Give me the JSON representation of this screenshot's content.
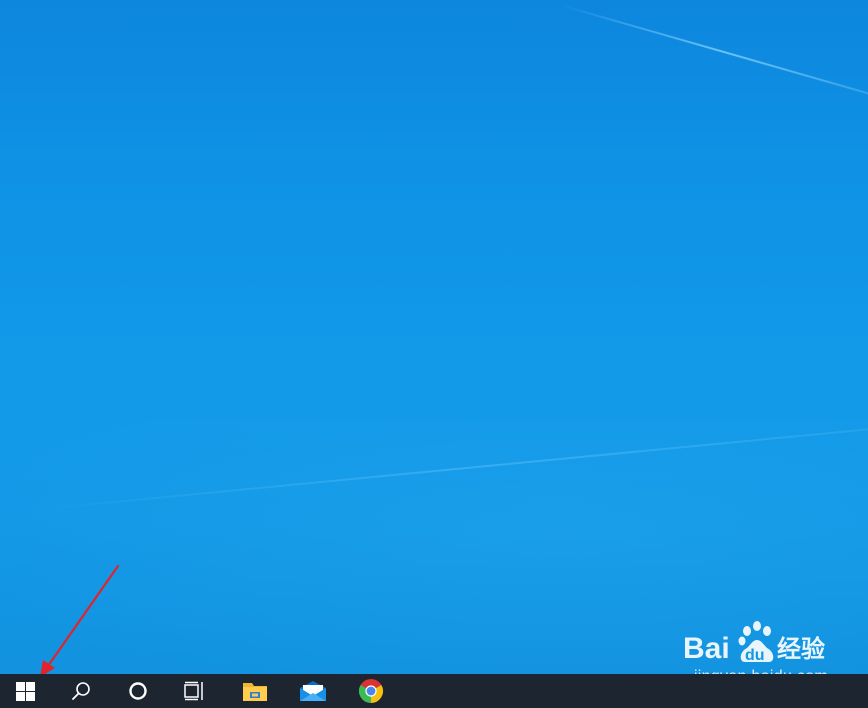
{
  "colors": {
    "desktop_top": "#0d86de",
    "desktop_bottom": "#1292df",
    "taskbar": "#1c2530",
    "annotation_arrow": "#e0242b",
    "icon_white": "#ffffff"
  },
  "taskbar": {
    "start": {
      "icon": "windows-logo-icon"
    },
    "search": {
      "icon": "search-icon"
    },
    "cortana": {
      "icon": "cortana-circle-icon"
    },
    "task_view": {
      "icon": "task-view-icon"
    },
    "pinned_apps": [
      {
        "name": "File Explorer",
        "icon": "folder-icon"
      },
      {
        "name": "Mail",
        "icon": "mail-icon"
      },
      {
        "name": "Google Chrome",
        "icon": "chrome-icon"
      }
    ]
  },
  "annotation": {
    "type": "arrow",
    "points_to": "start-button"
  },
  "watermark": {
    "logo_text": "Bai du 经验",
    "url": "jingyan.baidu.com"
  }
}
